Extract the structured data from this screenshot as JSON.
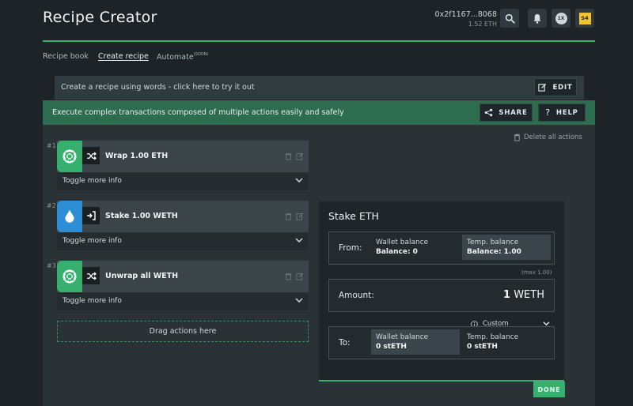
{
  "app": {
    "title": "Recipe Creator"
  },
  "wallet": {
    "address": "0x2f1167...8068",
    "balance": "1.52 ETH"
  },
  "header_icons": [
    "search-icon",
    "bell-icon",
    "gas-icon",
    "account-icon"
  ],
  "header_badges": {
    "gas": "1X",
    "account": "S4"
  },
  "nav": {
    "recipe_book": "Recipe book",
    "create_recipe": "Create recipe",
    "automate": "Automate",
    "automate_badge": "(SOON)"
  },
  "words_banner": {
    "text": "Create a recipe using words - click here to try it out",
    "edit_label": "EDIT"
  },
  "panel": {
    "description": "Execute complex transactions composed of multiple actions easily and safely",
    "share_label": "SHARE",
    "help_label": "HELP",
    "delete_all": "Delete all actions",
    "toggle_label": "Toggle more info",
    "dropzone": "Drag actions here"
  },
  "actions": [
    {
      "num": "#1",
      "label": "Wrap 1.00 ETH",
      "protocol_color": "#37b06f",
      "protocol_icon": "lifebuoy-icon",
      "type_icon": "shuffle-icon"
    },
    {
      "num": "#2",
      "label": "Stake 1.00 WETH",
      "protocol_color": "#2d8ed6",
      "protocol_icon": "drop-icon",
      "type_icon": "enter-icon"
    },
    {
      "num": "#3",
      "label": "Unwrap all WETH",
      "protocol_color": "#37b06f",
      "protocol_icon": "lifebuoy-icon",
      "type_icon": "shuffle-icon"
    }
  ],
  "stake_form": {
    "title": "Stake ETH",
    "from_label": "From:",
    "from_wallet": {
      "title": "Wallet balance",
      "value": "Balance: 0"
    },
    "from_temp": {
      "title": "Temp. balance",
      "value": "Balance: 1.00"
    },
    "max_hint": "(max 1.00)",
    "amount_label": "Amount:",
    "amount_value": "1",
    "amount_unit": "WETH",
    "custom_label": "Custom",
    "to_label": "To:",
    "to_wallet": {
      "title": "Wallet balance",
      "value": "0 stETH"
    },
    "to_temp": {
      "title": "Temp. balance",
      "value": "0 stETH"
    },
    "done_label": "DONE"
  },
  "colors": {
    "accent": "#37b06f",
    "header_green": "#2e6c4f",
    "lido_blue": "#2d8ed6"
  }
}
